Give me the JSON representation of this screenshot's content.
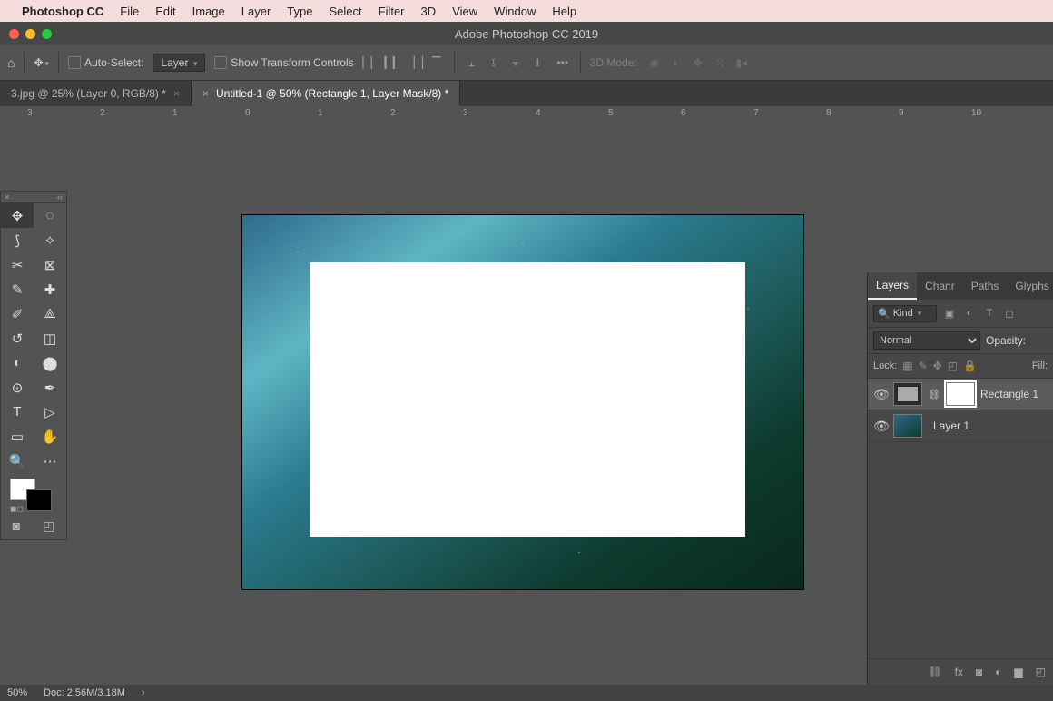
{
  "menubar": {
    "app": "Photoshop CC",
    "items": [
      "File",
      "Edit",
      "Image",
      "Layer",
      "Type",
      "Select",
      "Filter",
      "3D",
      "View",
      "Window",
      "Help"
    ]
  },
  "window_title": "Adobe Photoshop CC 2019",
  "options": {
    "auto_select": "Auto-Select:",
    "layer_sel": "Layer",
    "show_tc": "Show Transform Controls",
    "mode3d": "3D Mode:"
  },
  "tabs": [
    {
      "label": "3.jpg @ 25% (Layer 0, RGB/8) *"
    },
    {
      "label": "Untitled-1 @ 50% (Rectangle 1, Layer Mask/8) *",
      "active": true
    }
  ],
  "ruler_ticks": [
    "3",
    "2",
    "1",
    "0",
    "1",
    "2",
    "3",
    "4",
    "5",
    "6",
    "7",
    "8",
    "9",
    "10"
  ],
  "layers_panel": {
    "tabs": [
      "Layers",
      "Chanr",
      "Paths",
      "Glyphs"
    ],
    "kind": "Kind",
    "blend": "Normal",
    "opacity": "Opacity:",
    "lock": "Lock:",
    "fill": "Fill:",
    "layers": [
      {
        "name": "Rectangle 1",
        "selected": true,
        "has_mask": true
      },
      {
        "name": "Layer 1",
        "selected": false,
        "has_mask": false
      }
    ]
  },
  "status": {
    "zoom": "50%",
    "doc": "Doc: 2.56M/3.18M"
  }
}
